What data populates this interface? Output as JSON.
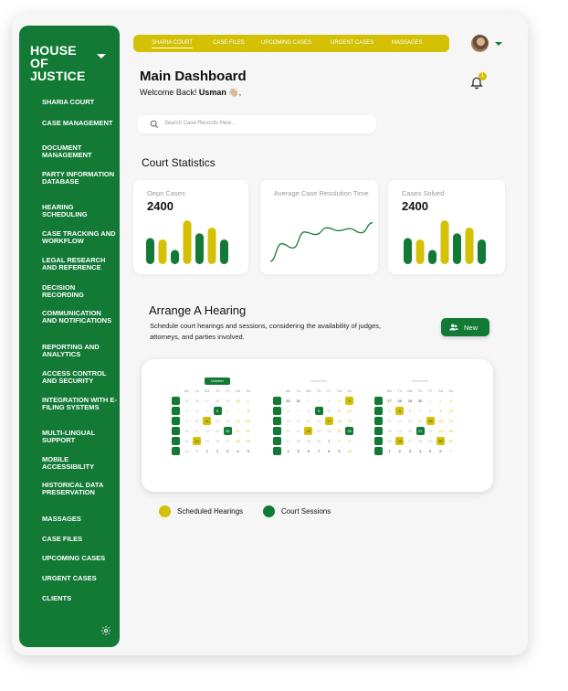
{
  "colors": {
    "brand_green": "#137a36",
    "accent_yellow": "#d4c004"
  },
  "sidebar": {
    "brand": "HOUSE OF JUSTICE",
    "items": [
      {
        "label": "SHARIA COURT"
      },
      {
        "label": "CASE MANAGEMENT"
      },
      {
        "label": "DOCUMENT MANAGEMENT"
      },
      {
        "label": "PARTY INFORMATION DATABASE"
      },
      {
        "label": "HEARING SCHEDULING"
      },
      {
        "label": "CASE TRACKING AND WORKFLOW"
      },
      {
        "label": "LEGAL RESEARCH AND REFERENCE"
      },
      {
        "label": "DECISION RECORDING"
      },
      {
        "label": "COMMUNICATION AND NOTIFICATIONS"
      },
      {
        "label": "REPORTING AND ANALYTICS"
      },
      {
        "label": "ACCESS CONTROL AND SECURITY"
      },
      {
        "label": "INTEGRATION WITH E-FILING SYSTEMS"
      },
      {
        "label": "MULTI-LINGUAL SUPPORT"
      },
      {
        "label": "MOBILE ACCESSIBILITY"
      },
      {
        "label": "HISTORICAL DATA PRESERVATION"
      },
      {
        "label": "MASSAGES"
      },
      {
        "label": "CASE FILES"
      },
      {
        "label": "UPCOMING CASES"
      },
      {
        "label": "URGENT CASES"
      },
      {
        "label": "CLIENTS"
      }
    ],
    "settings_icon": "gear-icon"
  },
  "topnav": {
    "items": [
      {
        "label": "SHARIA COURT",
        "active": true
      },
      {
        "label": "CASE FILES"
      },
      {
        "label": "UPCOMING CASES"
      },
      {
        "label": "URGENT CASES"
      },
      {
        "label": "MASSAGES"
      }
    ],
    "notification_count": "1"
  },
  "header": {
    "title": "Main Dashboard",
    "welcome_prefix": "Welcome Back!",
    "user_name": "Usman",
    "emoji": "👋🏼,"
  },
  "search": {
    "placeholder": "Search Case Records Here..."
  },
  "stats": {
    "section_title": "Court Statistics",
    "open_cases": {
      "label": "Oepn Cases",
      "value": "2400",
      "bars": [
        {
          "h": 0.55,
          "c": "g"
        },
        {
          "h": 0.52,
          "c": "y"
        },
        {
          "h": 0.3,
          "c": "g"
        },
        {
          "h": 0.92,
          "c": "y"
        },
        {
          "h": 0.65,
          "c": "g"
        },
        {
          "h": 0.77,
          "c": "y"
        },
        {
          "h": 0.52,
          "c": "g"
        }
      ]
    },
    "avg_resolution": {
      "label": "Average Case Resolution Time.",
      "line": [
        0.0,
        0.42,
        0.32,
        0.7,
        0.64,
        0.8,
        0.73,
        0.78,
        0.68,
        0.92
      ]
    },
    "cases_solved": {
      "label": "Cases Solved",
      "value": "2400",
      "bars": [
        {
          "h": 0.55,
          "c": "g"
        },
        {
          "h": 0.52,
          "c": "y"
        },
        {
          "h": 0.3,
          "c": "g"
        },
        {
          "h": 0.92,
          "c": "y"
        },
        {
          "h": 0.65,
          "c": "g"
        },
        {
          "h": 0.77,
          "c": "y"
        },
        {
          "h": 0.52,
          "c": "g"
        }
      ]
    }
  },
  "hearing": {
    "title": "Arrange A Hearing",
    "description": "Schedule court hearings and sessions, considering the availability of judges, attorneys, and parties involved.",
    "new_button": "New"
  },
  "calendar": {
    "weekdays": [
      "Mo",
      "Tu",
      "We",
      "Th",
      "Fr",
      "Sa",
      "Su"
    ],
    "months": [
      {
        "name": "October",
        "badge": true,
        "rows": [
          [
            [
              "25"
            ],
            [
              "26"
            ],
            [
              "27"
            ],
            [
              "28"
            ],
            [
              "29"
            ],
            [
              "30",
              "w"
            ],
            [
              "1",
              "w"
            ]
          ],
          [
            [
              "2"
            ],
            [
              "3"
            ],
            [
              "4"
            ],
            [
              "5",
              "g"
            ],
            [
              "6"
            ],
            [
              "7",
              "w"
            ],
            [
              "8",
              "w"
            ]
          ],
          [
            [
              "9"
            ],
            [
              "10"
            ],
            [
              "11",
              "y"
            ],
            [
              "12"
            ],
            [
              "13"
            ],
            [
              "14",
              "w"
            ],
            [
              "15",
              "w"
            ]
          ],
          [
            [
              "16"
            ],
            [
              "17"
            ],
            [
              "18"
            ],
            [
              "19"
            ],
            [
              "20",
              "g"
            ],
            [
              "21",
              "w"
            ],
            [
              "22",
              "w"
            ]
          ],
          [
            [
              "23"
            ],
            [
              "24",
              "y"
            ],
            [
              "25"
            ],
            [
              "26"
            ],
            [
              "27"
            ],
            [
              "28",
              "w"
            ],
            [
              "29",
              "w"
            ]
          ],
          [
            [
              "30"
            ],
            [
              "31"
            ],
            [
              "1",
              "d"
            ],
            [
              "2",
              "d"
            ],
            [
              "3",
              "d"
            ],
            [
              "4",
              "d"
            ],
            [
              "5",
              "d"
            ]
          ]
        ]
      },
      {
        "name": "November",
        "badge": false,
        "rows": [
          [
            [
              "30",
              "d"
            ],
            [
              "31",
              "d"
            ],
            [
              "1"
            ],
            [
              "2"
            ],
            [
              "3"
            ],
            [
              "4",
              "w"
            ],
            [
              "5",
              "y"
            ]
          ],
          [
            [
              "6"
            ],
            [
              "7"
            ],
            [
              "8"
            ],
            [
              "9",
              "g"
            ],
            [
              "10"
            ],
            [
              "11",
              "w"
            ],
            [
              "12",
              "w"
            ]
          ],
          [
            [
              "13"
            ],
            [
              "14"
            ],
            [
              "15"
            ],
            [
              "16"
            ],
            [
              "17",
              "y"
            ],
            [
              "18",
              "w"
            ],
            [
              "19",
              "w"
            ]
          ],
          [
            [
              "20"
            ],
            [
              "21"
            ],
            [
              "22",
              "y"
            ],
            [
              "23"
            ],
            [
              "24"
            ],
            [
              "25",
              "w"
            ],
            [
              "26",
              "g"
            ]
          ],
          [
            [
              "27"
            ],
            [
              "28"
            ],
            [
              "29"
            ],
            [
              "30"
            ],
            [
              "1",
              "d"
            ],
            [
              "2",
              "w"
            ],
            [
              "3",
              "w"
            ]
          ],
          [
            [
              "4",
              "d"
            ],
            [
              "5",
              "d"
            ],
            [
              "6",
              "d"
            ],
            [
              "7",
              "d"
            ],
            [
              "8",
              "d"
            ],
            [
              "9",
              "d"
            ],
            [
              "10",
              "w"
            ]
          ]
        ]
      },
      {
        "name": "December",
        "badge": false,
        "rows": [
          [
            [
              "27",
              "d"
            ],
            [
              "28",
              "d"
            ],
            [
              "29",
              "d"
            ],
            [
              "30",
              "d"
            ],
            [
              "1"
            ],
            [
              "2",
              "w"
            ],
            [
              "3",
              "w"
            ]
          ],
          [
            [
              "4"
            ],
            [
              "5",
              "y"
            ],
            [
              "6"
            ],
            [
              "7"
            ],
            [
              "8"
            ],
            [
              "9",
              "w"
            ],
            [
              "10",
              "w"
            ]
          ],
          [
            [
              "11"
            ],
            [
              "12"
            ],
            [
              "13"
            ],
            [
              "14"
            ],
            [
              "15",
              "y"
            ],
            [
              "16",
              "w"
            ],
            [
              "17",
              "w"
            ]
          ],
          [
            [
              "18"
            ],
            [
              "19"
            ],
            [
              "20"
            ],
            [
              "21",
              "g"
            ],
            [
              "22"
            ],
            [
              "23",
              "w"
            ],
            [
              "24",
              "w"
            ]
          ],
          [
            [
              "25"
            ],
            [
              "26",
              "y"
            ],
            [
              "27"
            ],
            [
              "28"
            ],
            [
              "29"
            ],
            [
              "30",
              "y"
            ],
            [
              "31",
              "w"
            ]
          ],
          [
            [
              "1",
              "d"
            ],
            [
              "2",
              "d"
            ],
            [
              "3",
              "d"
            ],
            [
              "4",
              "d"
            ],
            [
              "5",
              "d"
            ],
            [
              "6",
              "d"
            ],
            [
              "7",
              "w"
            ]
          ]
        ]
      }
    ]
  },
  "legend": {
    "scheduled": "Scheduled Hearings",
    "sessions": "Court Sessions"
  }
}
